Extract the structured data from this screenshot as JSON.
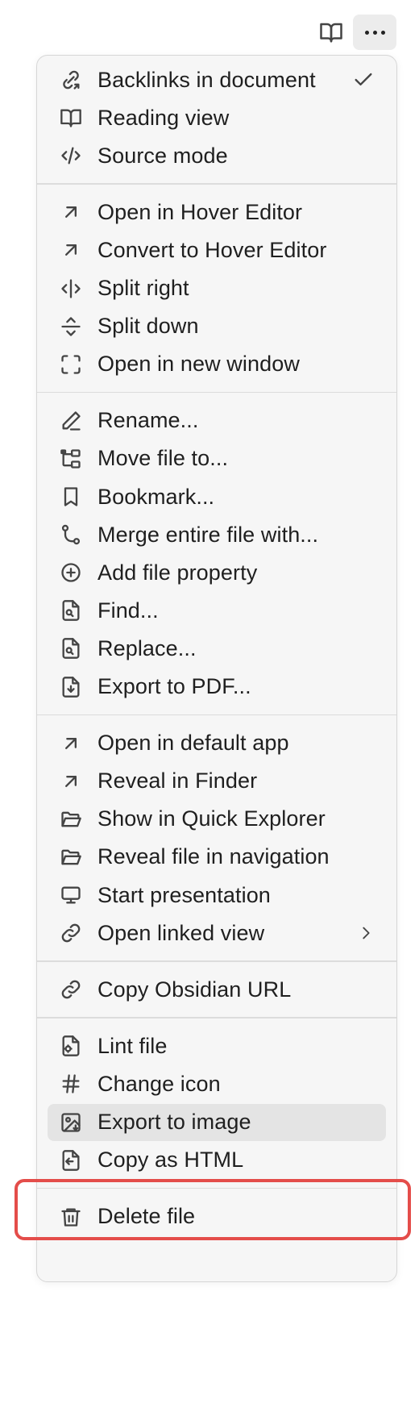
{
  "menu": {
    "groups": [
      {
        "items": [
          {
            "label": "Backlinks in document",
            "icon": "backlinks-icon",
            "checked": true
          },
          {
            "label": "Reading view",
            "icon": "book-open-icon"
          },
          {
            "label": "Source mode",
            "icon": "code-icon"
          }
        ]
      },
      {
        "items": [
          {
            "label": "Open in Hover Editor",
            "icon": "arrow-up-right-icon"
          },
          {
            "label": "Convert to Hover Editor",
            "icon": "arrow-up-right-icon"
          },
          {
            "label": "Split right",
            "icon": "split-right-icon"
          },
          {
            "label": "Split down",
            "icon": "split-down-icon"
          },
          {
            "label": "Open in new window",
            "icon": "maximize-icon"
          }
        ]
      },
      {
        "items": [
          {
            "label": "Rename...",
            "icon": "pencil-icon"
          },
          {
            "label": "Move file to...",
            "icon": "folder-tree-icon"
          },
          {
            "label": "Bookmark...",
            "icon": "bookmark-icon"
          },
          {
            "label": "Merge entire file with...",
            "icon": "merge-icon"
          },
          {
            "label": "Add file property",
            "icon": "plus-circle-icon"
          },
          {
            "label": "Find...",
            "icon": "file-search-icon"
          },
          {
            "label": "Replace...",
            "icon": "file-search-icon"
          },
          {
            "label": "Export to PDF...",
            "icon": "file-download-icon"
          }
        ]
      },
      {
        "items": [
          {
            "label": "Open in default app",
            "icon": "arrow-up-right-icon"
          },
          {
            "label": "Reveal in Finder",
            "icon": "arrow-up-right-icon"
          },
          {
            "label": "Show in Quick Explorer",
            "icon": "folder-open-icon"
          },
          {
            "label": "Reveal file in navigation",
            "icon": "folder-open-icon"
          },
          {
            "label": "Start presentation",
            "icon": "monitor-icon"
          },
          {
            "label": "Open linked view",
            "icon": "link-icon",
            "submenu": true
          }
        ]
      },
      {
        "items": [
          {
            "label": "Copy Obsidian URL",
            "icon": "link-icon"
          }
        ]
      },
      {
        "items": [
          {
            "label": "Lint file",
            "icon": "file-cog-icon"
          },
          {
            "label": "Change icon",
            "icon": "hash-icon"
          },
          {
            "label": "Export to image",
            "icon": "image-download-icon",
            "highlighted": true
          },
          {
            "label": "Copy as HTML",
            "icon": "file-copy-icon"
          }
        ]
      },
      {
        "items": [
          {
            "label": "Delete file",
            "icon": "trash-icon"
          }
        ]
      }
    ]
  },
  "topbar": {
    "reading_icon": "book-open-icon",
    "more_icon": "more-horizontal-icon"
  },
  "colors": {
    "callout": "#e44d4a",
    "menu_bg": "#f6f6f6",
    "highlight_bg": "#e4e4e4"
  }
}
